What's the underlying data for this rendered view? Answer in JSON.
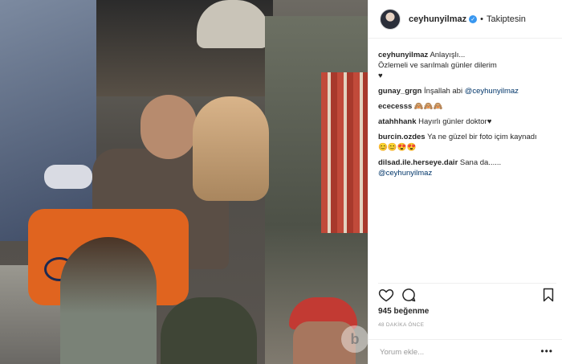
{
  "post": {
    "username": "ceyhunyilmaz",
    "follow_status": "Takiptesin",
    "likes": "945 beğenme",
    "time": "48 DAKİKA ÖNCE",
    "add_comment_placeholder": "Yorum ekle...",
    "more_options": "•••"
  },
  "comments": [
    {
      "user": "ceyhunyilmaz",
      "lines": [
        "Anlayışlı...",
        "Özlemeli ve sarılmalı günler dilerim",
        "♥"
      ]
    },
    {
      "user": "gunay_grgn",
      "text": "İnşallah abi",
      "mention": "@ceyhunyilmaz"
    },
    {
      "user": "ececesss",
      "text": "🙈🙈🙈"
    },
    {
      "user": "atahhhank",
      "text": "Hayırlı günler doktor♥"
    },
    {
      "user": "burcin.ozdes",
      "text": "Ya ne güzel bir foto içim kaynadı",
      "text2": "😊😊😍😍"
    },
    {
      "user": "dilsad.ile.herseye.dair",
      "text": "Sana da......",
      "mention": "@ceyhunyilmaz"
    }
  ],
  "icons": {
    "heart": "heart-icon",
    "comment": "comment-icon",
    "bookmark": "bookmark-icon",
    "verified": "verified-badge-icon"
  },
  "colors": {
    "verified": "#3897f0",
    "mention": "#003569",
    "muted": "#999999"
  }
}
